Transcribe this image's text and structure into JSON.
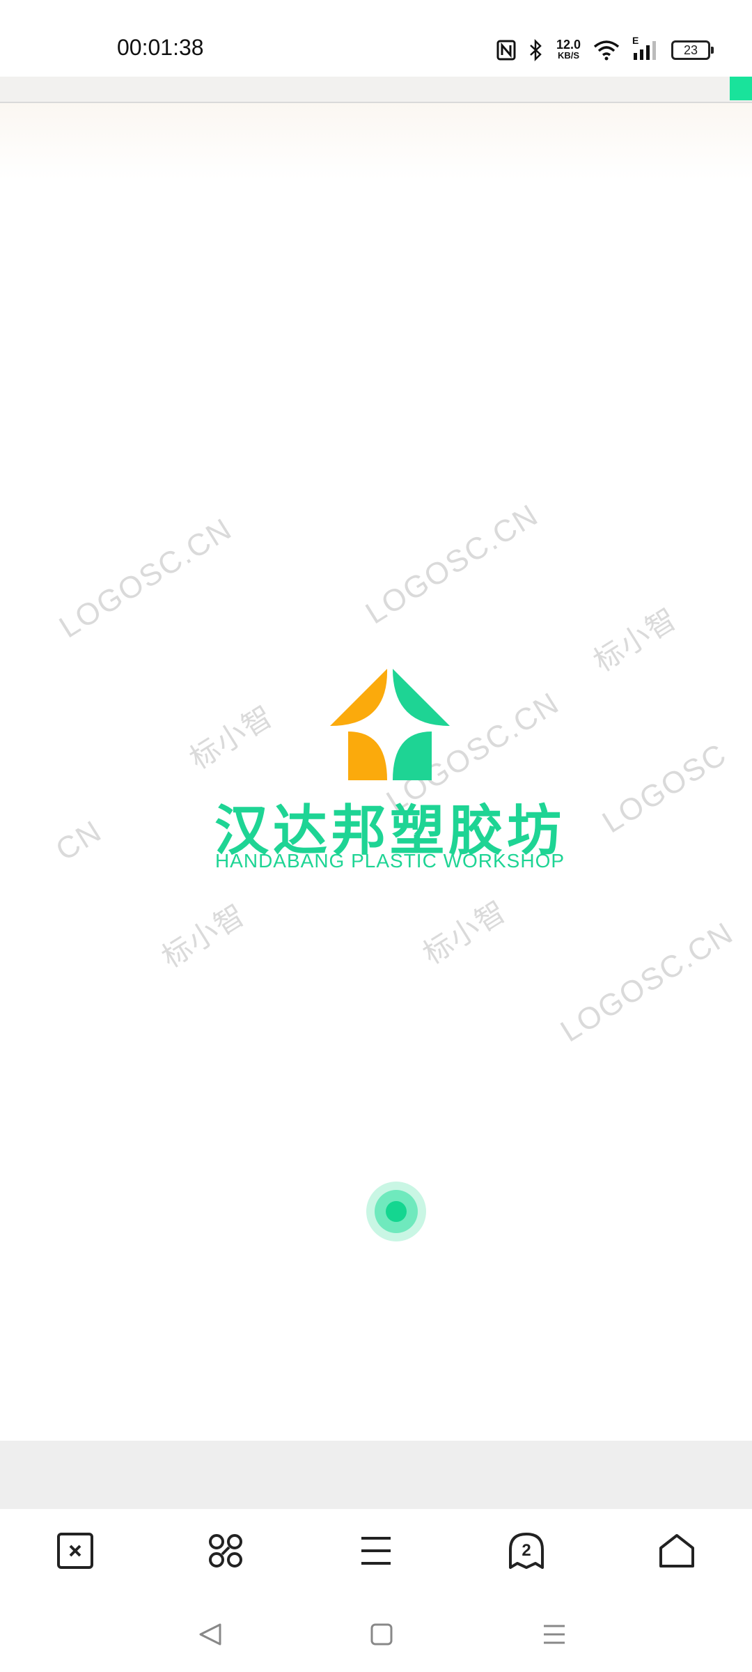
{
  "status_bar": {
    "time": "00:01:38",
    "network_speed": "12.0",
    "network_unit": "KB/S",
    "signal_type": "E",
    "battery": "23",
    "icons": [
      "nfc-icon",
      "bluetooth-icon",
      "wifi-icon",
      "signal-icon",
      "battery-icon"
    ]
  },
  "page_load": {
    "progress": 0.03,
    "accent_color": "#19e39b"
  },
  "watermarks": [
    "LOGOSC.CN",
    "LOGOSC.CN",
    "标小智",
    "标小智",
    "LOGOSC.CN",
    "LOGOSC",
    "CN",
    "标小智",
    "标小智",
    "LOGOSC.CN"
  ],
  "logo": {
    "name_cn": "汉达邦塑胶坊",
    "name_en": "HANDABANG PLASTIC WORKSHOP",
    "colors": {
      "green": "#1ed494",
      "orange": "#fbaa0c"
    }
  },
  "toolbar": {
    "items": [
      {
        "icon": "close-tab-icon"
      },
      {
        "icon": "command-icon"
      },
      {
        "icon": "menu-icon"
      },
      {
        "icon": "tabs-icon",
        "count": "2"
      },
      {
        "icon": "home-icon"
      }
    ]
  },
  "system_nav": {
    "items": [
      "back-icon",
      "home-square-icon",
      "recents-icon"
    ]
  }
}
